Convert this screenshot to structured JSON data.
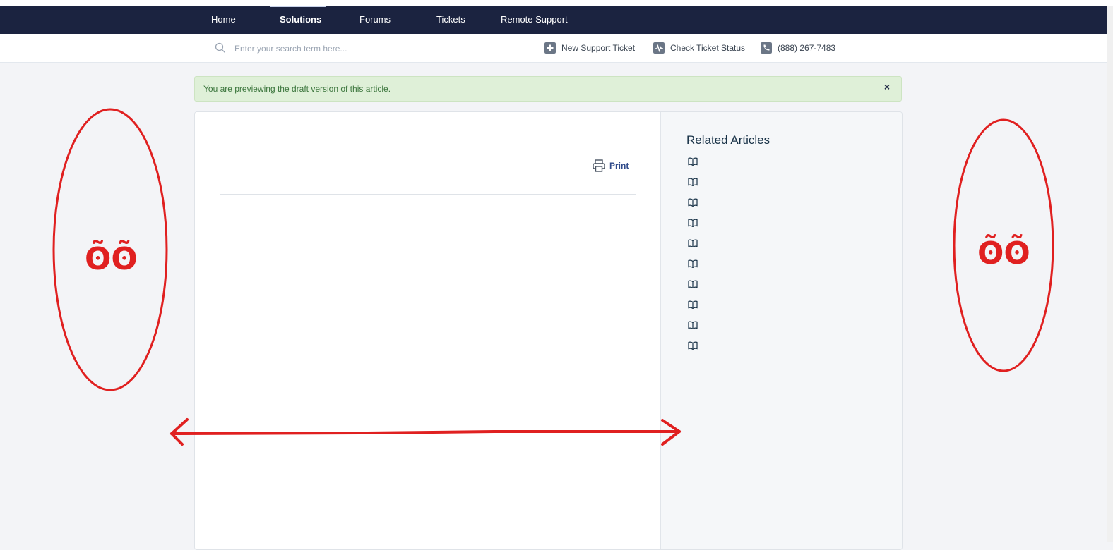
{
  "nav": {
    "items": [
      {
        "label": "Home",
        "active": false
      },
      {
        "label": "Solutions",
        "active": true
      },
      {
        "label": "Forums",
        "active": false
      },
      {
        "label": "Tickets",
        "active": false
      },
      {
        "label": "Remote Support",
        "active": false
      }
    ]
  },
  "subbar": {
    "search_placeholder": "Enter your search term here...",
    "actions": [
      {
        "label": "New Support Ticket",
        "icon": "plus-icon"
      },
      {
        "label": "Check Ticket Status",
        "icon": "pulse-icon"
      },
      {
        "label": "(888) 267-7483",
        "icon": "phone-icon"
      }
    ]
  },
  "alert": {
    "message": "You are previewing the draft version of this article.",
    "close": "×"
  },
  "article": {
    "print_label": "Print"
  },
  "sidebar": {
    "title": "Related Articles",
    "items": [
      {
        "icon": "book-icon",
        "label": ""
      },
      {
        "icon": "book-icon",
        "label": ""
      },
      {
        "icon": "book-icon",
        "label": ""
      },
      {
        "icon": "book-icon",
        "label": ""
      },
      {
        "icon": "book-icon",
        "label": ""
      },
      {
        "icon": "book-icon",
        "label": ""
      },
      {
        "icon": "book-icon",
        "label": ""
      },
      {
        "icon": "book-icon",
        "label": ""
      },
      {
        "icon": "book-icon",
        "label": ""
      },
      {
        "icon": "book-icon",
        "label": ""
      }
    ]
  },
  "annotation": {
    "eyes_glyph": "ʘ̃ʘ̃",
    "color": "#e02020"
  },
  "colors": {
    "nav_bg": "#1b2340",
    "alert_bg": "#dff0d8",
    "alert_text": "#3c763d",
    "page_bg": "#f3f4f7"
  }
}
